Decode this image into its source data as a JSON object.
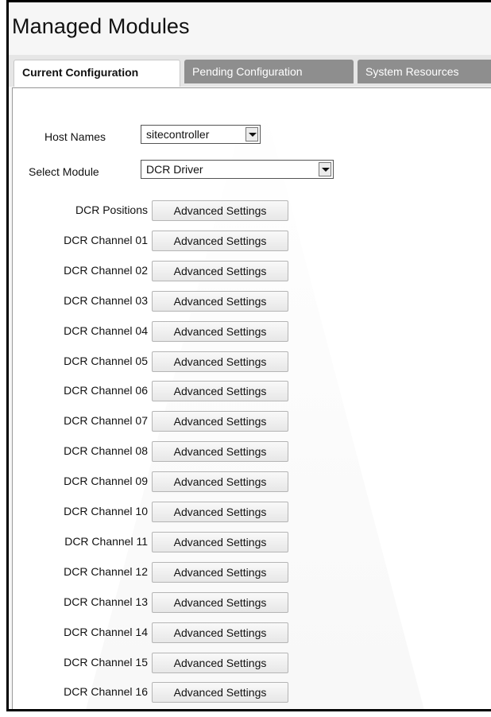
{
  "page": {
    "title": "Managed Modules"
  },
  "tabs": [
    {
      "label": "Current Configuration",
      "active": true
    },
    {
      "label": "Pending Configuration",
      "active": false
    },
    {
      "label": "System Resources",
      "active": false
    }
  ],
  "host": {
    "label": "Host Names",
    "value": "sitecontroller"
  },
  "module": {
    "label": "Select Module",
    "value": "DCR Driver"
  },
  "settings": {
    "button_label": "Advanced Settings",
    "rows": [
      "DCR Positions",
      "DCR Channel 01",
      "DCR Channel 02",
      "DCR Channel 03",
      "DCR Channel 04",
      "DCR Channel 05",
      "DCR Channel 06",
      "DCR Channel 07",
      "DCR Channel 08",
      "DCR Channel 09",
      "DCR Channel 10",
      "DCR Channel 11",
      "DCR Channel 12",
      "DCR Channel 13",
      "DCR Channel 14",
      "DCR Channel 15",
      "DCR Channel 16"
    ]
  },
  "colors": {
    "inactive_tab": "#8e8e8e",
    "tab_bar": "#e6e6e6",
    "frame": "#000000"
  },
  "icons": {
    "dropdown": "chevron-down-icon"
  }
}
